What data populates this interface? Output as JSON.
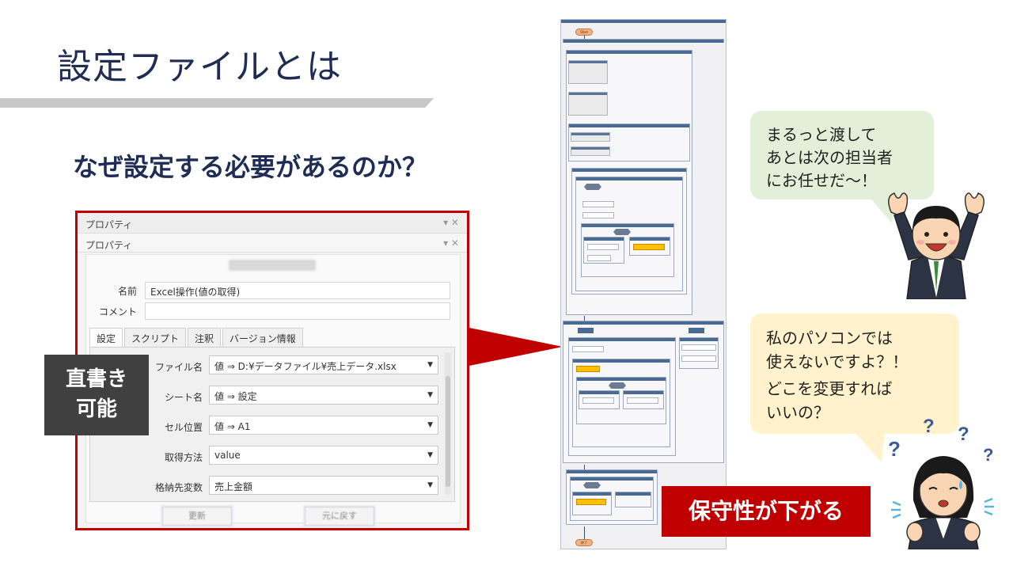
{
  "slide": {
    "title": "設定ファイルとは",
    "subtitle": "なぜ設定する必要があるのか？"
  },
  "dialog": {
    "outer_title": "プロパティ",
    "inner_title": "プロパティ",
    "name_label": "名前",
    "name_value": "Excel操作(値の取得)",
    "comment_label": "コメント",
    "comment_value": "",
    "tabs": [
      "設定",
      "スクリプト",
      "注釈",
      "バージョン情報"
    ],
    "properties": [
      {
        "label": "ファイル名",
        "value": "値 ⇒  D:¥データファイル¥売上データ.xlsx"
      },
      {
        "label": "シート名",
        "value": "値 ⇒  設定"
      },
      {
        "label": "セル位置",
        "value": "値 ⇒  A1"
      },
      {
        "label": "取得方法",
        "value": "value"
      },
      {
        "label": "格納先変数",
        "value": "売上金額"
      }
    ],
    "buttons": [
      "更新",
      "元に戻す"
    ]
  },
  "badge": {
    "line1": "直書き",
    "line2": "可能"
  },
  "callout": "保守性が下がる",
  "bubbles": {
    "green": [
      "まるっと渡して",
      "あとは次の担当者",
      "にお任せだ～！"
    ],
    "yellow": [
      "私のパソコンでは",
      "使えないですよ？！",
      "どこを変更すれば",
      "いいの？"
    ]
  },
  "flow": {
    "start": "Start",
    "end": "終了"
  },
  "colors": {
    "title": "#1f2d55",
    "accent_red": "#c00000",
    "badge_gray": "#404040",
    "bubble_green": "#e3efd9",
    "bubble_yellow": "#fff2cc"
  }
}
